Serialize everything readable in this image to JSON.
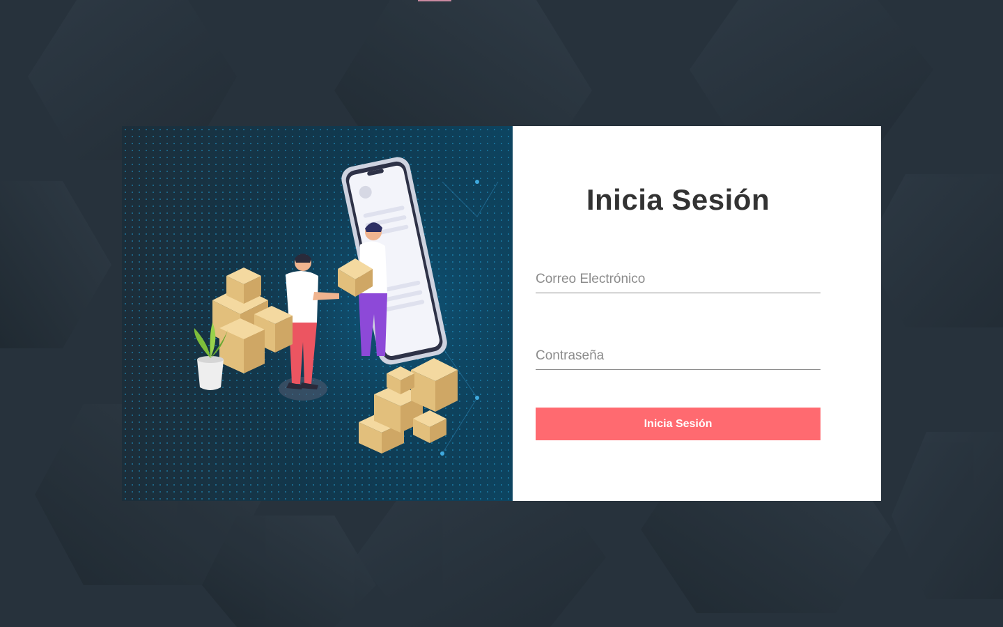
{
  "login": {
    "title": "Inicia Sesión",
    "email_placeholder": "Correo Electrónico",
    "password_placeholder": "Contraseña",
    "submit_label": "Inicia Sesión"
  },
  "colors": {
    "background": "#27323c",
    "button": "#ff6a70",
    "title": "#333333"
  },
  "icons": {
    "illustration": "delivery-phone-boxes-illustration"
  }
}
